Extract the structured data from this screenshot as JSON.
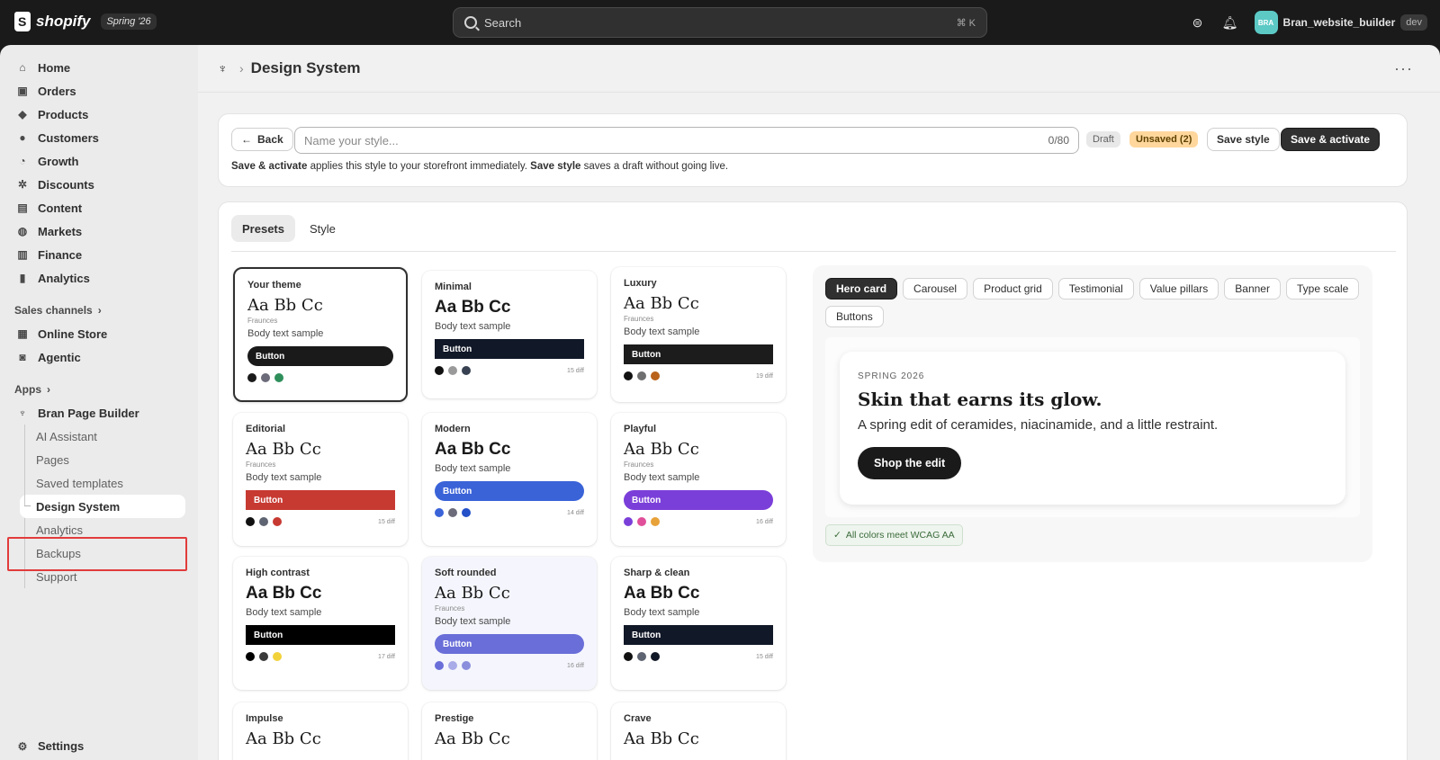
{
  "topbar": {
    "brand": "shopify",
    "season": "Spring '26",
    "search_placeholder": "Search",
    "shortcut": "⌘  K",
    "user_initials": "BRA",
    "username": "Bran_website_builder",
    "env_badge": "dev"
  },
  "sidebar": {
    "items": [
      {
        "label": "Home",
        "icon": "home-icon"
      },
      {
        "label": "Orders",
        "icon": "orders-icon"
      },
      {
        "label": "Products",
        "icon": "tag-icon"
      },
      {
        "label": "Customers",
        "icon": "person-icon"
      },
      {
        "label": "Growth",
        "icon": "growth-icon"
      },
      {
        "label": "Discounts",
        "icon": "discount-icon"
      },
      {
        "label": "Content",
        "icon": "content-icon"
      },
      {
        "label": "Markets",
        "icon": "globe-icon"
      },
      {
        "label": "Finance",
        "icon": "bank-icon"
      },
      {
        "label": "Analytics",
        "icon": "bar-chart-icon"
      }
    ],
    "sales_channels_label": "Sales channels",
    "sales_channels": [
      {
        "label": "Online Store",
        "icon": "store-icon"
      },
      {
        "label": "Agentic",
        "icon": "agent-icon"
      }
    ],
    "apps_label": "Apps",
    "app_name": "Bran Page Builder",
    "app_sub": [
      "AI Assistant",
      "Pages",
      "Saved templates",
      "Design System",
      "Analytics",
      "Backups",
      "Support"
    ],
    "settings": "Settings"
  },
  "page": {
    "title": "Design System",
    "back": "Back",
    "name_placeholder": "Name your style...",
    "name_count": "0/80",
    "draft": "Draft",
    "unsaved": "Unsaved (2)",
    "save_style": "Save style",
    "save_activate": "Save & activate",
    "hint_1": "Save & activate",
    "hint_2": " applies this style to your storefront immediately. ",
    "hint_3": "Save style",
    "hint_4": " saves a draft without going live."
  },
  "tabs": [
    "Presets",
    "Style"
  ],
  "presets": [
    {
      "name": "Your theme",
      "sample": "Aa Bb Cc",
      "font": "Fraunces",
      "body": "Body text sample",
      "button": "Button",
      "btn_color": "#1a1a1a",
      "dots": [
        "#1a1a1a",
        "#6b6b7a",
        "#2f8f5b"
      ],
      "diff": ""
    },
    {
      "name": "Minimal",
      "sample": "Aa Bb Cc",
      "font": "",
      "body": "Body text sample",
      "button": "Button",
      "btn_color": "#111827",
      "dots": [
        "#111111",
        "#9a9a9a",
        "#374151"
      ],
      "diff": "15 diff"
    },
    {
      "name": "Luxury",
      "sample": "Aa Bb Cc",
      "font": "Fraunces",
      "body": "Body text sample",
      "button": "Button",
      "btn_color": "#1c1c1c",
      "dots": [
        "#111111",
        "#6f6f6f",
        "#b8621b"
      ],
      "diff": "19 diff"
    },
    {
      "name": "Editorial",
      "sample": "Aa Bb Cc",
      "font": "Fraunces",
      "body": "Body text sample",
      "button": "Button",
      "btn_color": "#c73a32",
      "dots": [
        "#111111",
        "#5f6472",
        "#c73a32"
      ],
      "diff": "15 diff"
    },
    {
      "name": "Modern",
      "sample": "Aa Bb Cc",
      "font": "",
      "body": "Body text sample",
      "button": "Button",
      "btn_color": "#3a63d8",
      "dots": [
        "#3a63d8",
        "#6b6b7a",
        "#2450c8"
      ],
      "diff": "14 diff"
    },
    {
      "name": "Playful",
      "sample": "Aa Bb Cc",
      "font": "Fraunces",
      "body": "Body text sample",
      "button": "Button",
      "btn_color": "#7b3fd9",
      "dots": [
        "#7b3fd9",
        "#e0509a",
        "#e8a23a"
      ],
      "diff": "16 diff"
    },
    {
      "name": "High contrast",
      "sample": "Aa Bb Cc",
      "font": "",
      "body": "Body text sample",
      "button": "Button",
      "btn_color": "#000000",
      "dots": [
        "#000000",
        "#3a3a3a",
        "#f2d23a"
      ],
      "diff": "17 diff"
    },
    {
      "name": "Soft rounded",
      "sample": "Aa Bb Cc",
      "font": "Fraunces",
      "body": "Body text sample",
      "button": "Button",
      "btn_color": "#6a6ed8",
      "dots": [
        "#6a6ed8",
        "#a9abe8",
        "#8a8edc"
      ],
      "diff": "16 diff"
    },
    {
      "name": "Sharp & clean",
      "sample": "Aa Bb Cc",
      "font": "",
      "body": "Body text sample",
      "button": "Button",
      "btn_color": "#111827",
      "dots": [
        "#111111",
        "#5f6472",
        "#111827"
      ],
      "diff": "15 diff"
    },
    {
      "name": "Impulse",
      "sample": "Aa Bb Cc",
      "font": "",
      "body": "",
      "button": "",
      "btn_color": "#1a1a1a",
      "dots": [],
      "diff": ""
    },
    {
      "name": "Prestige",
      "sample": "Aa Bb Cc",
      "font": "",
      "body": "",
      "button": "",
      "btn_color": "#1a1a1a",
      "dots": [],
      "diff": ""
    },
    {
      "name": "Crave",
      "sample": "Aa Bb Cc",
      "font": "",
      "body": "",
      "button": "",
      "btn_color": "#1a1a1a",
      "dots": [],
      "diff": ""
    }
  ],
  "preview": {
    "chips": [
      "Hero card",
      "Carousel",
      "Product grid",
      "Testimonial",
      "Value pillars",
      "Banner",
      "Type scale",
      "Buttons"
    ],
    "eyebrow": "SPRING 2026",
    "title": "Skin that earns its glow.",
    "subtitle": "A spring edit of ceramides, niacinamide, and a little restraint.",
    "cta": "Shop the edit",
    "wcag": "All colors meet WCAG AA"
  }
}
